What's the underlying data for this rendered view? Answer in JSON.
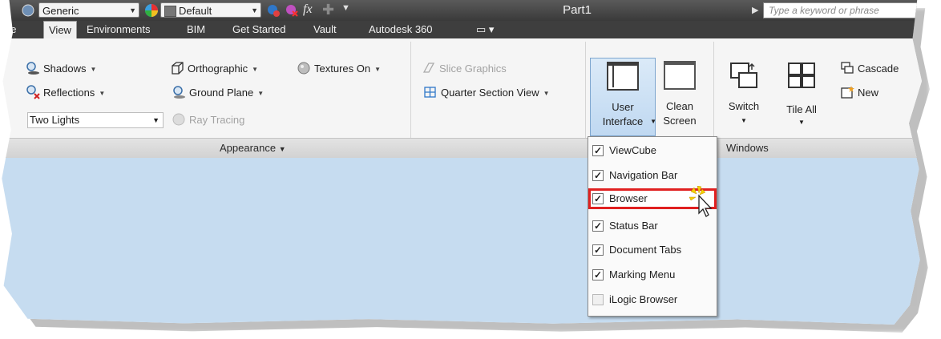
{
  "titlebar": {
    "style_combo": "Generic",
    "appearance_combo": "Default",
    "fx_label": "fx",
    "document_title": "Part1",
    "search_placeholder": "Type a keyword or phrase"
  },
  "tabs": [
    {
      "label": "ne"
    },
    {
      "label": "View"
    },
    {
      "label": "Environments"
    },
    {
      "label": "BIM"
    },
    {
      "label": "Get Started"
    },
    {
      "label": "Vault"
    },
    {
      "label": "Autodesk 360"
    }
  ],
  "active_tab": "View",
  "appearance_panel": {
    "shadows": "Shadows",
    "reflections": "Reflections",
    "lighting_combo": "Two Lights",
    "orthographic": "Orthographic",
    "textures": "Textures On",
    "ground_plane": "Ground Plane",
    "ray_tracing": "Ray Tracing",
    "label": "Appearance"
  },
  "section_panel": {
    "slice_graphics": "Slice Graphics",
    "quarter_section_view": "Quarter Section View"
  },
  "ui_panel": {
    "user_interface_line1": "User",
    "user_interface_line2": "Interface",
    "clean_screen_line1": "Clean",
    "clean_screen_line2": "Screen"
  },
  "windows_panel": {
    "switch": "Switch",
    "tile_all": "Tile All",
    "cascade": "Cascade",
    "new": "New",
    "label": "Windows"
  },
  "user_interface_menu": [
    {
      "label": "ViewCube",
      "checked": true
    },
    {
      "label": "Navigation Bar",
      "checked": true
    },
    {
      "label": "Browser",
      "checked": true,
      "highlighted": true
    },
    {
      "label": "Status Bar",
      "checked": true
    },
    {
      "label": "Document Tabs",
      "checked": true
    },
    {
      "label": "Marking Menu",
      "checked": true
    },
    {
      "label": "iLogic Browser",
      "checked": false
    }
  ],
  "colors": {
    "canvas": "#c6dcf0",
    "highlight_border": "#e02020",
    "title_bar": "#3e3e3e"
  }
}
